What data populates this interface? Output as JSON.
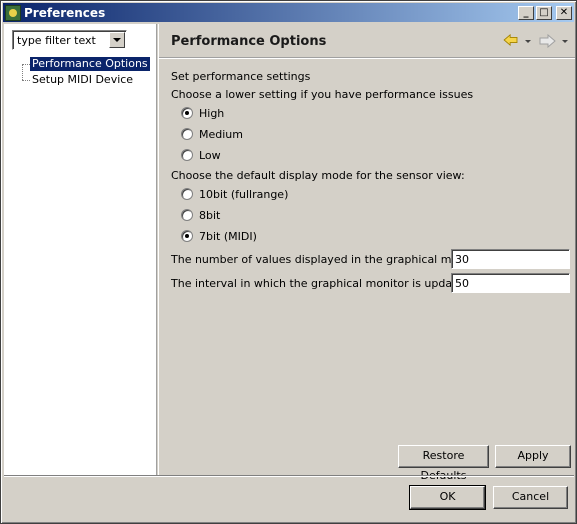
{
  "window": {
    "title": "Preferences"
  },
  "titlebar": {
    "minimize": "_",
    "maximize": "□",
    "close": "✕"
  },
  "sidebar": {
    "filter_text": "type filter text",
    "items": [
      {
        "label": "Performance Options",
        "selected": true
      },
      {
        "label": "Setup MIDI Device",
        "selected": false
      }
    ]
  },
  "page": {
    "title": "Performance Options",
    "nav_icons": [
      "back-arrow-icon",
      "forward-arrow-icon"
    ],
    "intro": "Set performance settings",
    "performance_prompt": "Choose a lower setting if you have performance issues",
    "performance_options": [
      {
        "label": "High",
        "checked": true
      },
      {
        "label": "Medium",
        "checked": false
      },
      {
        "label": "Low",
        "checked": false
      }
    ],
    "display_prompt": "Choose the default display mode for the sensor view:",
    "display_options": [
      {
        "label": "10bit (fullrange)",
        "checked": false
      },
      {
        "label": "8bit",
        "checked": false
      },
      {
        "label": "7bit (MIDI)",
        "checked": true
      }
    ],
    "values_label": "The number of values displayed in the graphical monitor:",
    "values_value": "30",
    "interval_label": "The interval in which the graphical monitor is updated:",
    "interval_value": "50",
    "restore_label": "Restore Defaults",
    "apply_label": "Apply"
  },
  "footer": {
    "ok_label": "OK",
    "cancel_label": "Cancel"
  },
  "colors": {
    "title_start": "#0a246a",
    "title_end": "#a6caf0",
    "selection": "#0a246a",
    "face": "#d4d0c8",
    "nav_arrow": "#e6b800"
  }
}
